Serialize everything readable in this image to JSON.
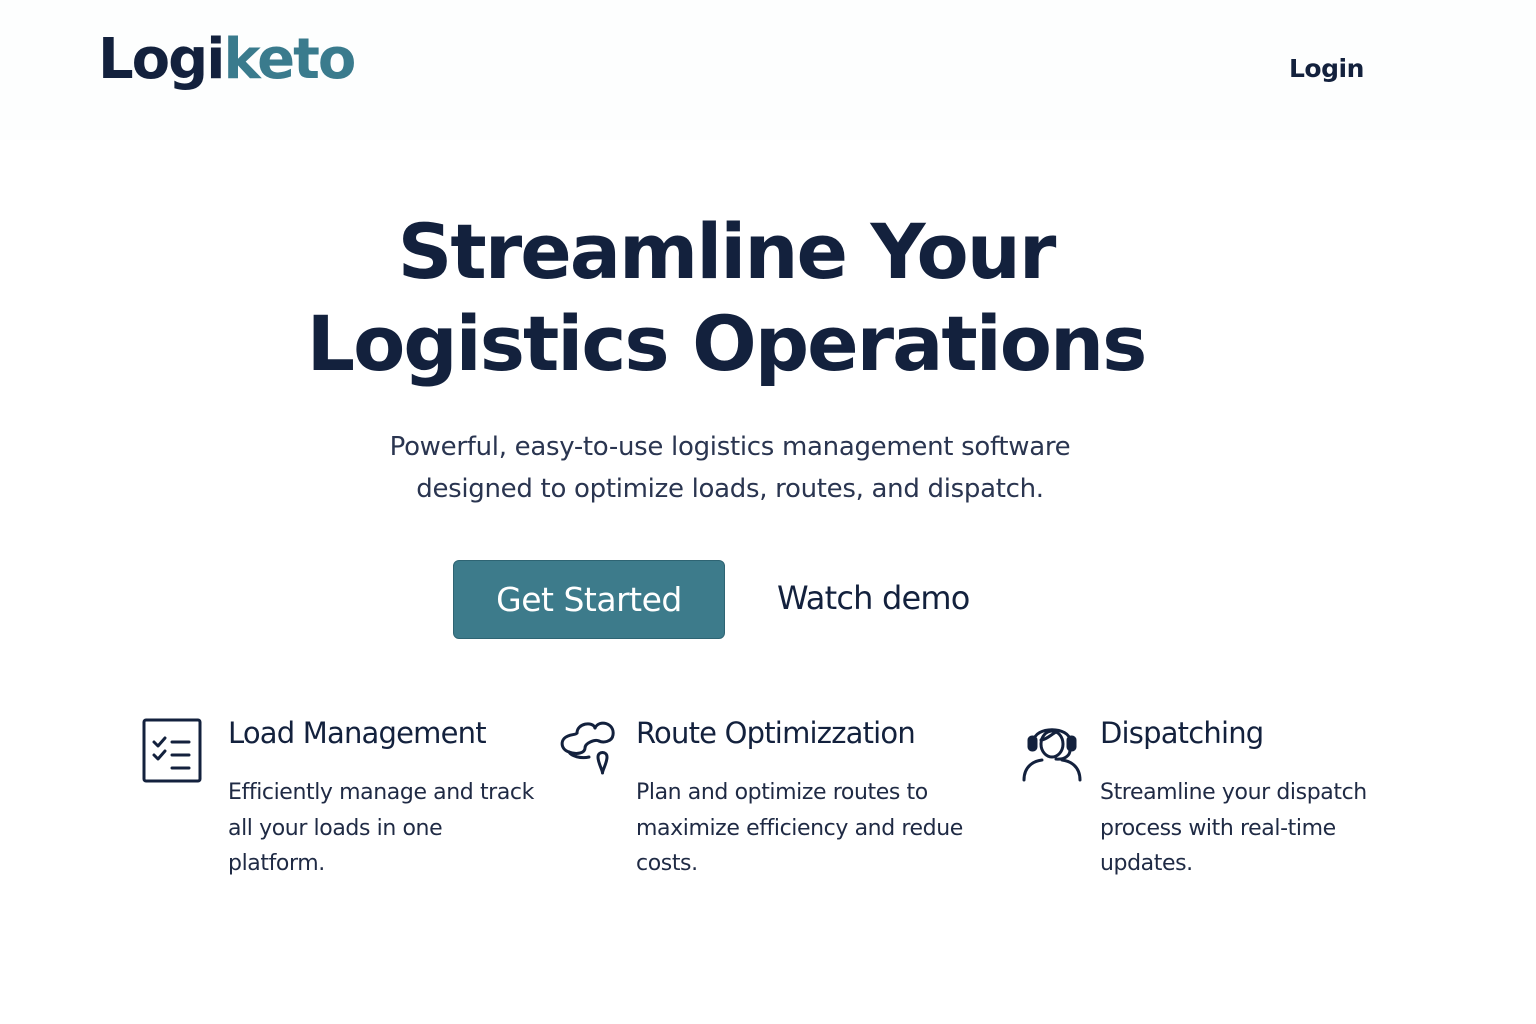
{
  "header": {
    "logo_part1": "Logi",
    "logo_part2": "keto",
    "login_label": "Login"
  },
  "hero": {
    "title_line1": "Streamline Your",
    "title_line2": "Logistics Operations",
    "subtitle_line1": "Powerful, easy-to-use logistics management software",
    "subtitle_line2": "designed to optimize loads, routes, and dispatch.",
    "primary_cta": "Get Started",
    "secondary_cta": "Watch demo"
  },
  "features": [
    {
      "icon": "checklist-icon",
      "title": "Load Management",
      "desc_lines": [
        "Efficiently manage and track",
        "all your loads in one",
        "platform."
      ]
    },
    {
      "icon": "route-icon",
      "title": "Route Optimizzation",
      "desc_lines": [
        "Plan and optimize routes to",
        "maximize efficiency and redue",
        "costs."
      ]
    },
    {
      "icon": "headset-agent-icon",
      "title": "Dispatching",
      "desc_lines": [
        "Streamline your dispatch",
        "process with real-time",
        "updates."
      ]
    }
  ],
  "colors": {
    "navy": "#13213d",
    "teal": "#3d7b8b",
    "logo_teal": "#3a7b8d",
    "background": "#ffffff"
  }
}
